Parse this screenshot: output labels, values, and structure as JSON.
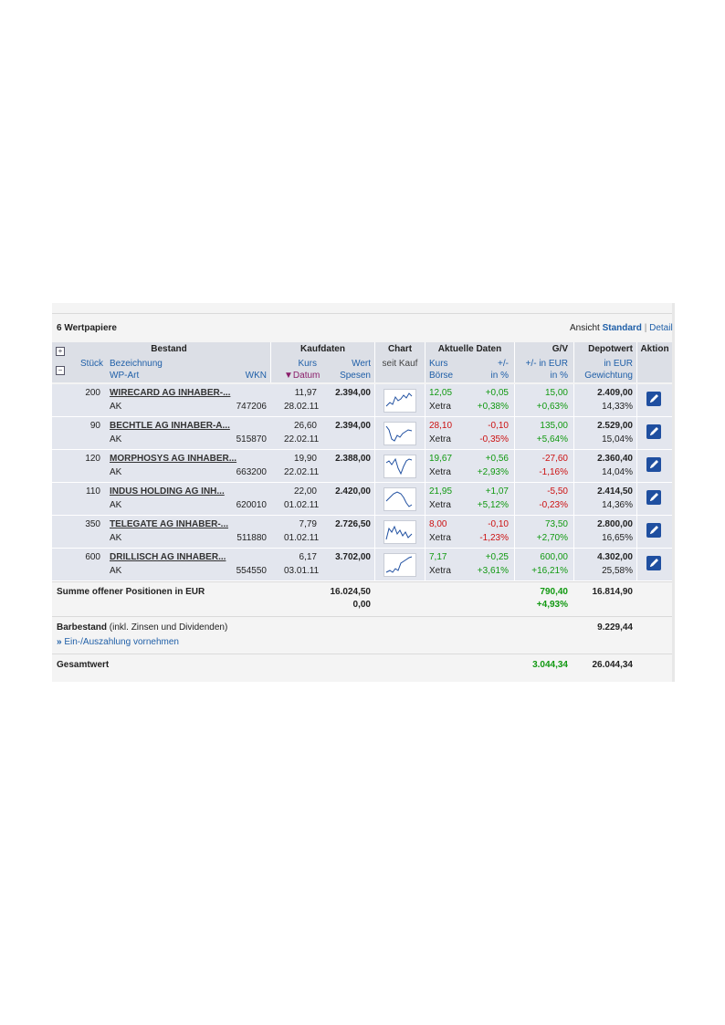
{
  "header": {
    "count_label": "6 Wertpapiere",
    "view_prefix": "Ansicht",
    "view_standard": "Standard",
    "view_separator": "|",
    "view_detail": "Detail"
  },
  "columns": {
    "bestand": "Bestand",
    "kaufdaten": "Kaufdaten",
    "chart": "Chart",
    "aktuelle": "Aktuelle Daten",
    "gv": "G/V",
    "depotwert": "Depotwert",
    "aktion": "Aktion",
    "stueck": "Stück",
    "bezeichnung": "Bezeichnung",
    "wpart": "WP-Art",
    "wkn": "WKN",
    "kurs": "Kurs",
    "wert": "Wert",
    "datum": "Datum",
    "spesen": "Spesen",
    "seit_kauf": "seit Kauf",
    "akt_kurs": "Kurs",
    "akt_pm": "+/-",
    "boerse": "Börse",
    "in_pct": "in %",
    "gv_eur": "+/- in EUR",
    "gv_pct": "in %",
    "depot_eur": "in EUR",
    "gewichtung": "Gewichtung"
  },
  "rows": [
    {
      "stueck": "200",
      "name": "WIRECARD AG INHABER-...",
      "art": "AK",
      "wkn": "747206",
      "kurs": "11,97",
      "datum": "28.02.11",
      "wert": "2.394,00",
      "akt_kurs": "12,05",
      "boerse": "Xetra",
      "pm": "+0,05",
      "pm_pct": "+0,38%",
      "gv": "15,00",
      "gv_pct": "+0,63%",
      "depot": "2.409,00",
      "gew": "14,33%",
      "kurs_color": "green",
      "pm_color": "green",
      "gv_color": "green"
    },
    {
      "stueck": "90",
      "name": "BECHTLE AG INHABER-A...",
      "art": "AK",
      "wkn": "515870",
      "kurs": "26,60",
      "datum": "22.02.11",
      "wert": "2.394,00",
      "akt_kurs": "28,10",
      "boerse": "Xetra",
      "pm": "-0,10",
      "pm_pct": "-0,35%",
      "gv": "135,00",
      "gv_pct": "+5,64%",
      "depot": "2.529,00",
      "gew": "15,04%",
      "kurs_color": "red",
      "pm_color": "red",
      "gv_color": "green"
    },
    {
      "stueck": "120",
      "name": "MORPHOSYS AG INHABER...",
      "art": "AK",
      "wkn": "663200",
      "kurs": "19,90",
      "datum": "22.02.11",
      "wert": "2.388,00",
      "akt_kurs": "19,67",
      "boerse": "Xetra",
      "pm": "+0,56",
      "pm_pct": "+2,93%",
      "gv": "-27,60",
      "gv_pct": "-1,16%",
      "depot": "2.360,40",
      "gew": "14,04%",
      "kurs_color": "green",
      "pm_color": "green",
      "gv_color": "red"
    },
    {
      "stueck": "110",
      "name": "INDUS HOLDING AG INH...",
      "art": "AK",
      "wkn": "620010",
      "kurs": "22,00",
      "datum": "01.02.11",
      "wert": "2.420,00",
      "akt_kurs": "21,95",
      "boerse": "Xetra",
      "pm": "+1,07",
      "pm_pct": "+5,12%",
      "gv": "-5,50",
      "gv_pct": "-0,23%",
      "depot": "2.414,50",
      "gew": "14,36%",
      "kurs_color": "green",
      "pm_color": "green",
      "gv_color": "red"
    },
    {
      "stueck": "350",
      "name": "TELEGATE AG INHABER-...",
      "art": "AK",
      "wkn": "511880",
      "kurs": "7,79",
      "datum": "01.02.11",
      "wert": "2.726,50",
      "akt_kurs": "8,00",
      "boerse": "Xetra",
      "pm": "-0,10",
      "pm_pct": "-1,23%",
      "gv": "73,50",
      "gv_pct": "+2,70%",
      "depot": "2.800,00",
      "gew": "16,65%",
      "kurs_color": "red",
      "pm_color": "red",
      "gv_color": "green"
    },
    {
      "stueck": "600",
      "name": "DRILLISCH AG INHABER...",
      "art": "AK",
      "wkn": "554550",
      "kurs": "6,17",
      "datum": "03.01.11",
      "wert": "3.702,00",
      "akt_kurs": "7,17",
      "boerse": "Xetra",
      "pm": "+0,25",
      "pm_pct": "+3,61%",
      "gv": "600,00",
      "gv_pct": "+16,21%",
      "depot": "4.302,00",
      "gew": "25,58%",
      "kurs_color": "green",
      "pm_color": "green",
      "gv_color": "green"
    }
  ],
  "summary": {
    "label": "Summe offener Positionen in EUR",
    "wert": "16.024,50",
    "spesen": "0,00",
    "gv": "790,40",
    "gv_pct": "+4,93%",
    "depot": "16.814,90"
  },
  "cash": {
    "label_bold": "Barbestand",
    "label_rest": "(inkl. Zinsen und Dividenden)",
    "link_arrow": "»",
    "link": "Ein-/Auszahlung vornehmen",
    "value": "9.229,44"
  },
  "total": {
    "label": "Gesamtwert",
    "gv": "3.044,34",
    "depot": "26.044,34"
  },
  "icons": {
    "expand": "plus-box-icon",
    "collapse": "minus-box-icon",
    "sort": "triangle-down-icon",
    "edit": "edit-pen-icon"
  },
  "colors": {
    "green": "#119911",
    "red": "#cc1111",
    "link": "#1f5fa8",
    "row": "#e3e6ee",
    "action": "#1f4fa0"
  }
}
